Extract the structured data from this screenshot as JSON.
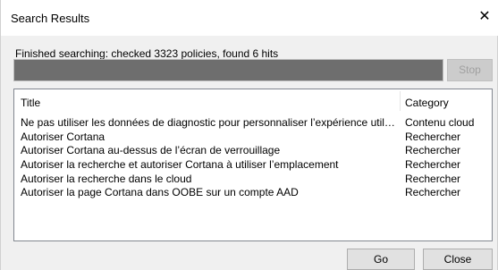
{
  "window": {
    "title": "Search Results",
    "close_glyph": "✕"
  },
  "status_text": "Finished searching: checked 3323 policies, found 6 hits",
  "progress": {
    "fraction": 1.0
  },
  "buttons": {
    "stop": "Stop",
    "go": "Go",
    "close": "Close"
  },
  "results": {
    "columns": {
      "title": "Title",
      "category": "Category"
    },
    "rows": [
      {
        "title": "Ne pas utiliser les données de diagnostic pour personnaliser l’expérience utilisat...",
        "category": "Contenu cloud"
      },
      {
        "title": "Autoriser Cortana",
        "category": "Rechercher"
      },
      {
        "title": "Autoriser Cortana au-dessus de l’écran de verrouillage",
        "category": "Rechercher"
      },
      {
        "title": "Autoriser la recherche et autoriser Cortana à utiliser l’emplacement",
        "category": "Rechercher"
      },
      {
        "title": "Autoriser la recherche dans le cloud",
        "category": "Rechercher"
      },
      {
        "title": "Autoriser la page Cortana dans OOBE sur un compte AAD",
        "category": "Rechercher"
      }
    ]
  }
}
